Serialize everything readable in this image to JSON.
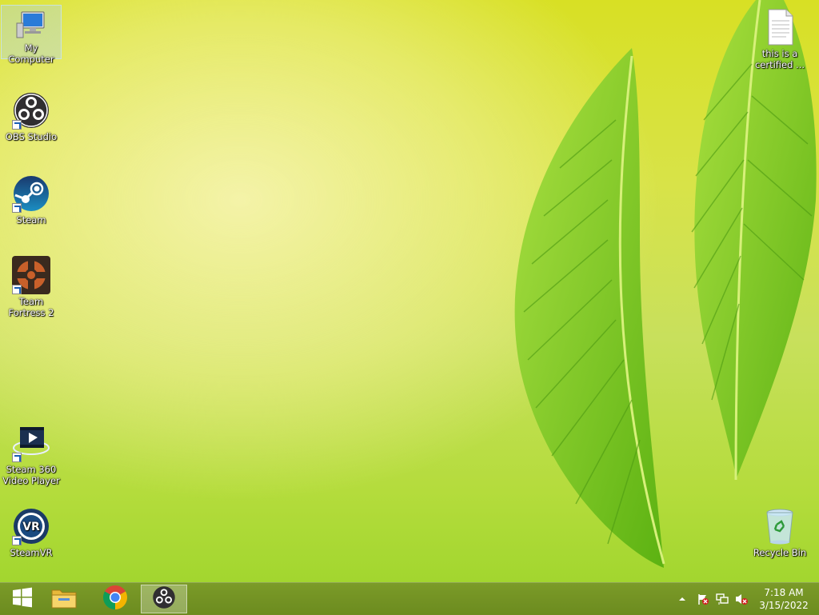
{
  "desktop": {
    "icons": [
      {
        "label": "My Computer"
      },
      {
        "label": "OBS Studio"
      },
      {
        "label": "Steam"
      },
      {
        "label": "Team Fortress 2"
      },
      {
        "label": "Steam 360 Video Player"
      },
      {
        "label": "SteamVR"
      },
      {
        "label": "this is a certified ..."
      },
      {
        "label": "Recycle Bin"
      }
    ]
  },
  "taskbar": {
    "buttons": [
      {
        "name": "Start",
        "icon": "windows-logo-icon"
      },
      {
        "name": "File Explorer",
        "icon": "folder-icon"
      },
      {
        "name": "Google Chrome",
        "icon": "chrome-icon"
      },
      {
        "name": "OBS Studio",
        "icon": "obs-icon",
        "active": true
      }
    ],
    "tray": {
      "icons": [
        "show-hidden-icons-arrow",
        "action-center-flag-icon",
        "network-icon",
        "volume-muted-icon"
      ],
      "time": "7:18 AM",
      "date": "3/15/2022"
    }
  },
  "colors": {
    "wallpaper": "#d8e024",
    "taskbar": "#7a9628",
    "obs": "#302e31",
    "steam": "#1b2838"
  }
}
